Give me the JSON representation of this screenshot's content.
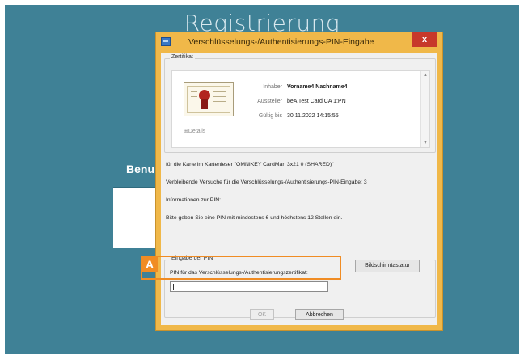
{
  "background": {
    "title": "Registrierung",
    "panel_heading": "Benu"
  },
  "dialog": {
    "title": "Verschlüsselungs-/Authentisierungs-PIN-Eingabe",
    "close_label": "x"
  },
  "certificate": {
    "group_label": "Zertifikat",
    "rows": [
      {
        "key": "Inhaber",
        "value": "Vorname4 Nachname4"
      },
      {
        "key": "Aussteller",
        "value": "beA Test Card CA 1:PN"
      },
      {
        "key": "Gültig bis",
        "value": "30.11.2022 14:15:55"
      }
    ],
    "details_label": "Details"
  },
  "info": [
    "für die Karte im Kartenleser \"OMNIKEY CardMan 3x21 0 (SHARED)\"",
    "Verbleibende Versuche für die Verschlüsselungs-/Authentisierungs-PIN-Eingabe: 3",
    "Informationen zur PIN:",
    "Bitte geben Sie eine PIN mit mindestens 6 und höchstens 12 Stellen ein."
  ],
  "pin": {
    "group_label": "Eingabe der PIN",
    "field_label": "PIN für das Verschlüsselungs-/Authentisierungszertifikat:",
    "value": "",
    "keyboard_button": "Bildschirmtastatur"
  },
  "buttons": {
    "ok": "OK",
    "cancel": "Abbrechen"
  },
  "annotation": {
    "marker": "A"
  },
  "colors": {
    "background": "#3f8196",
    "dialog_frame": "#f0b849",
    "close_button": "#c7392b",
    "annotation": "#f08c24"
  }
}
